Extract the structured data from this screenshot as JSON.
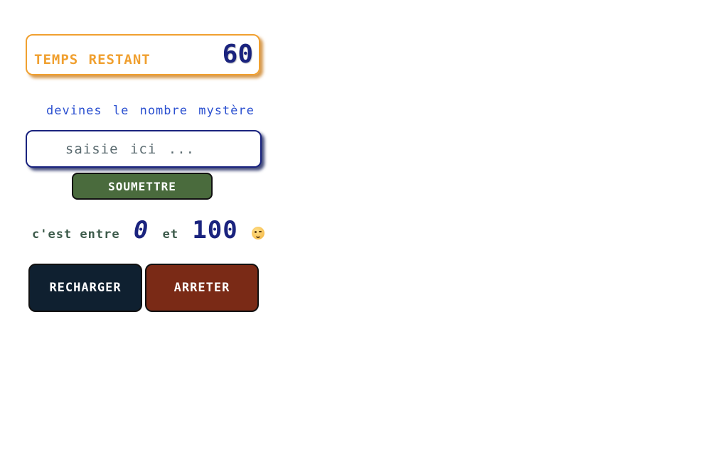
{
  "timer": {
    "label": "TEMPS RESTANT",
    "value": "60"
  },
  "prompt": {
    "text": "devines le nombre mystère"
  },
  "input": {
    "placeholder": "saisie ici ...",
    "value": ""
  },
  "submit": {
    "label": "SOUMETTRE"
  },
  "range": {
    "prefix": "c'est entre",
    "min": "0",
    "conjunction": "et",
    "max": "100",
    "emoji_icon": "winking-face-icon"
  },
  "actions": {
    "reload_label": "RECHARGER",
    "stop_label": "ARRETER"
  },
  "colors": {
    "timer_accent": "#f0a030",
    "number_color": "#1a237e",
    "prompt_color": "#2b50d0",
    "submit_bg": "#4a6b3d",
    "reload_bg": "#0f2030",
    "stop_bg": "#7a2a16"
  }
}
